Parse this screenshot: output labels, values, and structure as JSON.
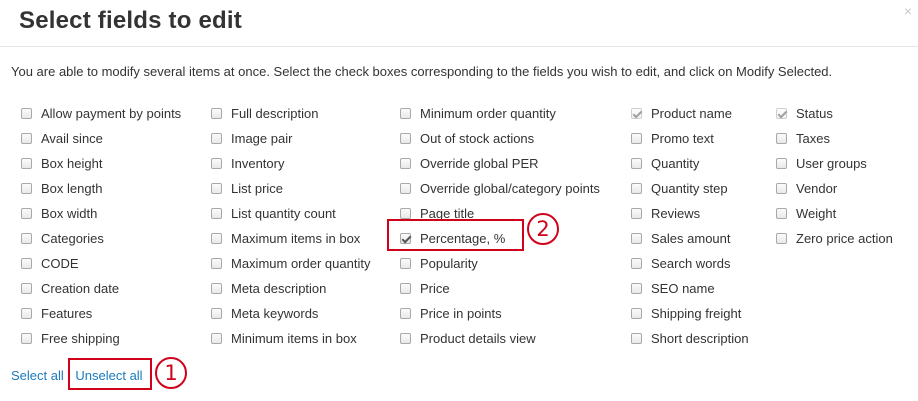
{
  "dialog": {
    "title": "Select fields to edit",
    "close_glyph": "×",
    "intro": "You are able to modify several items at once. Select the check boxes corresponding to the fields you wish to edit, and click on Modify Selected."
  },
  "columns": [
    [
      {
        "label": "Allow payment by points",
        "checked": false
      },
      {
        "label": "Avail since",
        "checked": false
      },
      {
        "label": "Box height",
        "checked": false
      },
      {
        "label": "Box length",
        "checked": false
      },
      {
        "label": "Box width",
        "checked": false
      },
      {
        "label": "Categories",
        "checked": false
      },
      {
        "label": "CODE",
        "checked": false
      },
      {
        "label": "Creation date",
        "checked": false
      },
      {
        "label": "Features",
        "checked": false
      },
      {
        "label": "Free shipping",
        "checked": false
      }
    ],
    [
      {
        "label": "Full description",
        "checked": false
      },
      {
        "label": "Image pair",
        "checked": false
      },
      {
        "label": "Inventory",
        "checked": false
      },
      {
        "label": "List price",
        "checked": false
      },
      {
        "label": "List quantity count",
        "checked": false
      },
      {
        "label": "Maximum items in box",
        "checked": false
      },
      {
        "label": "Maximum order quantity",
        "checked": false
      },
      {
        "label": "Meta description",
        "checked": false
      },
      {
        "label": "Meta keywords",
        "checked": false
      },
      {
        "label": "Minimum items in box",
        "checked": false
      }
    ],
    [
      {
        "label": "Minimum order quantity",
        "checked": false
      },
      {
        "label": "Out of stock actions",
        "checked": false
      },
      {
        "label": "Override global PER",
        "checked": false
      },
      {
        "label": "Override global/category points",
        "checked": false
      },
      {
        "label": "Page title",
        "checked": false
      },
      {
        "label": "Percentage, %",
        "checked": true
      },
      {
        "label": "Popularity",
        "checked": false
      },
      {
        "label": "Price",
        "checked": false
      },
      {
        "label": "Price in points",
        "checked": false
      },
      {
        "label": "Product details view",
        "checked": false
      }
    ],
    [
      {
        "label": "Product name",
        "checked": true,
        "disabled": true
      },
      {
        "label": "Promo text",
        "checked": false
      },
      {
        "label": "Quantity",
        "checked": false
      },
      {
        "label": "Quantity step",
        "checked": false
      },
      {
        "label": "Reviews",
        "checked": false
      },
      {
        "label": "Sales amount",
        "checked": false
      },
      {
        "label": "Search words",
        "checked": false
      },
      {
        "label": "SEO name",
        "checked": false
      },
      {
        "label": "Shipping freight",
        "checked": false
      },
      {
        "label": "Short description",
        "checked": false
      }
    ],
    [
      {
        "label": "Status",
        "checked": true,
        "disabled": true
      },
      {
        "label": "Taxes",
        "checked": false
      },
      {
        "label": "User groups",
        "checked": false
      },
      {
        "label": "Vendor",
        "checked": false
      },
      {
        "label": "Weight",
        "checked": false
      },
      {
        "label": "Zero price action",
        "checked": false
      }
    ]
  ],
  "links": {
    "select_all": "Select all",
    "unselect_all": "Unselect all"
  },
  "annotations": {
    "marker_1": "1",
    "marker_2": "2",
    "color": "#d0021b"
  },
  "colors": {
    "link": "#1a7bbd",
    "title": "#333333"
  }
}
